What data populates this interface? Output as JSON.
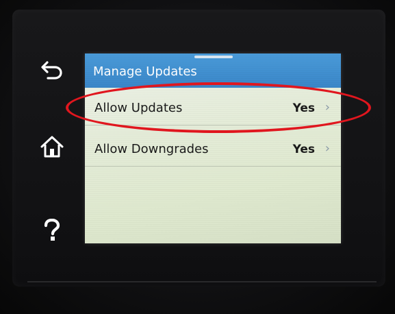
{
  "screen": {
    "title": "Manage Updates",
    "items": [
      {
        "label": "Allow Updates",
        "value": "Yes",
        "chevron": "›"
      },
      {
        "label": "Allow Downgrades",
        "value": "Yes",
        "chevron": "›"
      }
    ]
  },
  "sidebar": {
    "icons": [
      "back-icon",
      "home-icon",
      "help-icon"
    ]
  },
  "annotation": {
    "shape": "ellipse",
    "color": "#e0161e",
    "target": "Allow Updates"
  },
  "colors": {
    "title_bar": "#3a86c8",
    "screen_bg": "#e4ecd8",
    "bezel": "#151517"
  }
}
